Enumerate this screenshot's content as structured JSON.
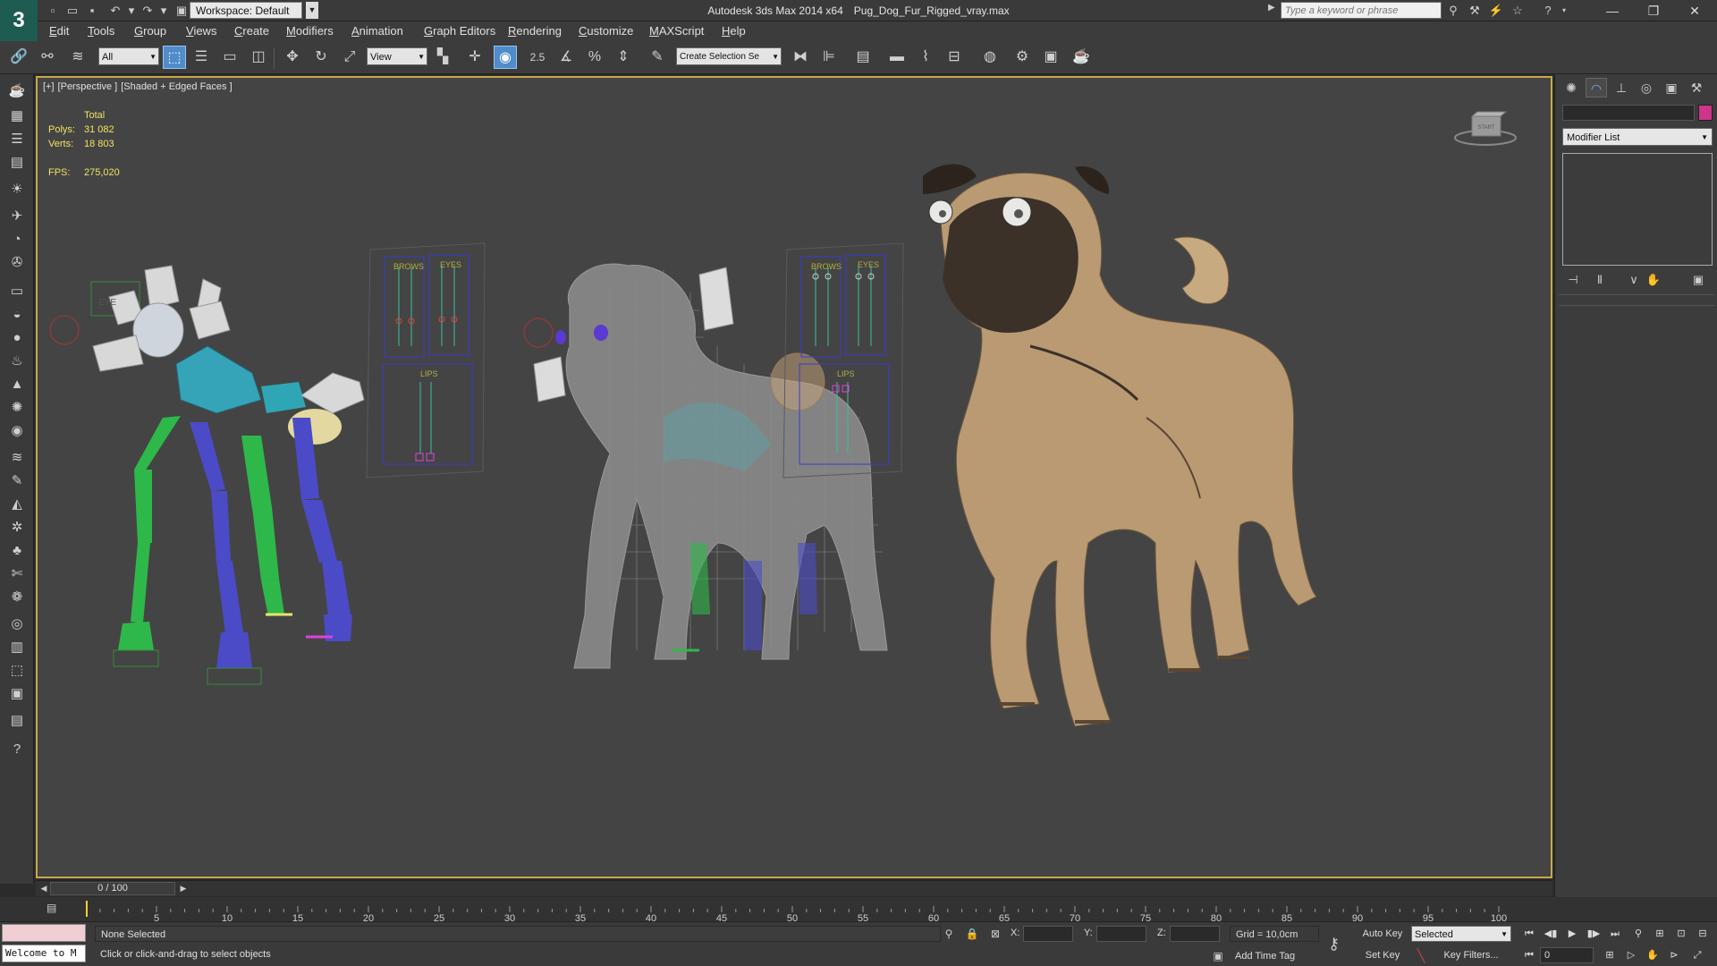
{
  "titlebar": {
    "workspace": "Workspace: Default",
    "app_name": "Autodesk 3ds Max  2014 x64",
    "file_name": "Pug_Dog_Fur_Rigged_vray.max",
    "search_placeholder": "Type a keyword or phrase"
  },
  "menu": [
    "Edit",
    "Tools",
    "Group",
    "Views",
    "Create",
    "Modifiers",
    "Animation",
    "Graph Editors",
    "Rendering",
    "Customize",
    "MAXScript",
    "Help"
  ],
  "toolbar": {
    "selection_filter": "All",
    "ref_coord": "View",
    "snap_value": "2.5",
    "named_selection": "Create Selection Se"
  },
  "viewport": {
    "labels": [
      "[+]",
      "[Perspective ]",
      "[Shaded + Edged Faces ]"
    ],
    "stats": {
      "total_label": "Total",
      "polys_label": "Polys:",
      "polys_value": "31 082",
      "verts_label": "Verts:",
      "verts_value": "18 803",
      "fps_label": "FPS:",
      "fps_value": "275,020"
    },
    "viewcube_label": "START",
    "panel_labels": {
      "brows": "BROWS",
      "eyes": "EYES",
      "lips": "LIPS",
      "eye_ghost": "EYE"
    }
  },
  "timeslider": {
    "position": "0 / 100"
  },
  "trackbar": {
    "ticks": [
      "0",
      "5",
      "10",
      "15",
      "20",
      "25",
      "30",
      "35",
      "40",
      "45",
      "50",
      "55",
      "60",
      "65",
      "70",
      "75",
      "80",
      "85",
      "90",
      "95",
      "100"
    ]
  },
  "status": {
    "maxscript_output": "Welcome to M",
    "selection": "None Selected",
    "prompt": "Click or click-and-drag to select objects",
    "x_label": "X:",
    "y_label": "Y:",
    "z_label": "Z:",
    "grid": "Grid = 10,0cm",
    "add_time_tag": "Add Time Tag",
    "auto_key": "Auto Key",
    "set_key": "Set Key",
    "key_mode": "Selected",
    "key_filters": "Key Filters...",
    "frame": "0"
  },
  "cmdpanel": {
    "modifier_list": "Modifier List",
    "object_color": "#d0338a"
  },
  "colors": {
    "viewport_bg": "#444444",
    "active_border": "#c9a84a",
    "stats_text": "#f2e266",
    "accent": "#4f8cc9"
  }
}
